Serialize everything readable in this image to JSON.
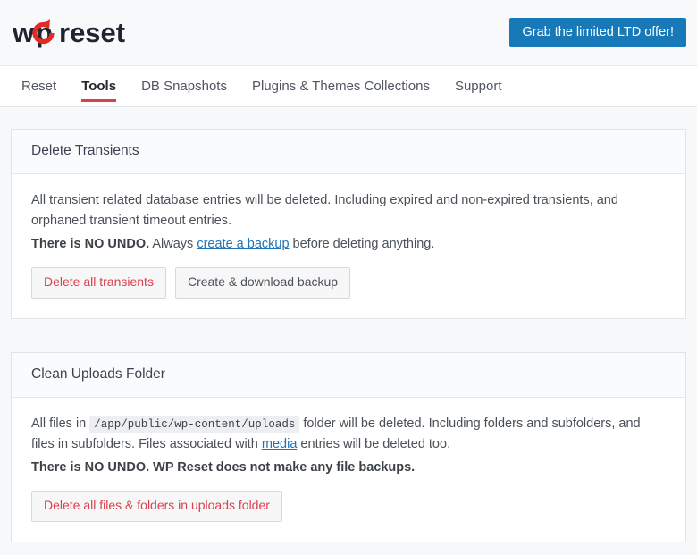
{
  "header": {
    "logo_text": "wpreset",
    "logo_word_1": "w",
    "logo_word_2": "p",
    "logo_word_3": "reset",
    "logo_accent_color": "#e02b27",
    "logo_text_color": "#1f2430",
    "cta_label": "Grab the limited LTD offer!",
    "cta_color": "#1879b9"
  },
  "nav": {
    "items": [
      {
        "label": "Reset",
        "active": false
      },
      {
        "label": "Tools",
        "active": true
      },
      {
        "label": "DB Snapshots",
        "active": false
      },
      {
        "label": "Plugins & Themes Collections",
        "active": false
      },
      {
        "label": "Support",
        "active": false
      }
    ],
    "active_underline_color": "#d8404a"
  },
  "cards": [
    {
      "title": "Delete Transients",
      "body_line_1": "All transient related database entries will be deleted. Including expired and non-expired transients, and orphaned transient timeout entries.",
      "warning_bold": "There is NO UNDO.",
      "warning_mid": " Always ",
      "warning_link": "create a backup",
      "warning_tail": " before deleting anything.",
      "buttons": [
        {
          "label": "Delete all transients",
          "style": "danger"
        },
        {
          "label": "Create & download backup",
          "style": "neutral"
        }
      ]
    },
    {
      "title": "Clean Uploads Folder",
      "body_prefix": "All files in ",
      "body_path": "/app/public/wp-content/uploads",
      "body_mid": " folder will be deleted. Including folders and subfolders, and files in subfolders. Files associated with ",
      "body_link": "media",
      "body_tail": " entries will be deleted too.",
      "warning_bold": "There is NO UNDO. WP Reset does not make any file backups.",
      "buttons": [
        {
          "label": "Delete all files & folders in uploads folder",
          "style": "danger"
        }
      ]
    }
  ]
}
